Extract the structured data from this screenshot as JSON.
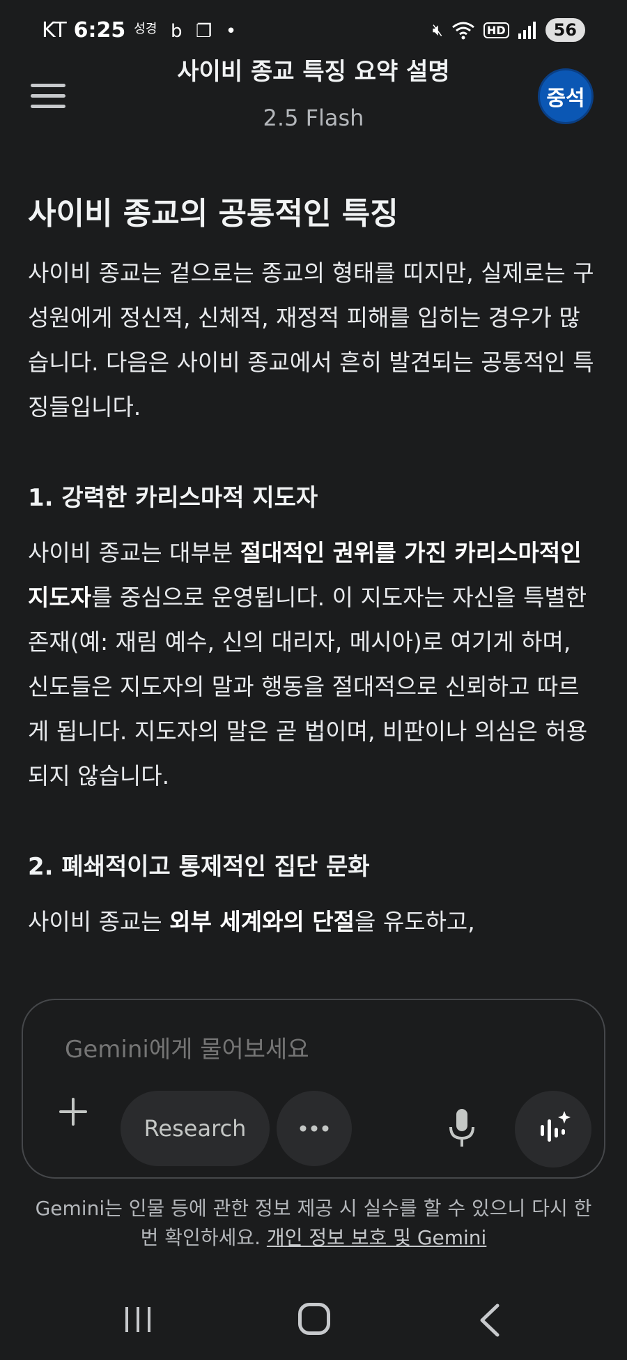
{
  "status_bar": {
    "carrier": "KT",
    "time": "6:25",
    "extra_text": "성경",
    "battery": "56"
  },
  "header": {
    "title": "사이비 종교 특징 요약 설명",
    "model": "2.5 Flash",
    "avatar_text": "중석"
  },
  "content": {
    "heading": "사이비 종교의 공통적인 특징",
    "intro": "사이비 종교는 겉으로는 종교의 형태를 띠지만, 실제로는 구성원에게 정신적, 신체적, 재정적 피해를 입히는 경우가 많습니다. 다음은 사이비 종교에서 흔히 발견되는 공통적인 특징들입니다.",
    "section1": {
      "title": "1. 강력한 카리스마적 지도자",
      "p1": "사이비 종교는 대부분 ",
      "b1": "절대적인 권위를 가진 카리스마적인 지도자",
      "p2": "를 중심으로 운영됩니다. 이 지도자는 자신을 특별한 존재(예: 재림 예수, 신의 대리자, 메시아)로 여기게 하며, 신도들은 지도자의 말과 행동을 절대적으로 신뢰하고 따르게 됩니다. 지도자의 말은 곧 법이며, 비판이나 의심은 허용되지 않습니다."
    },
    "section2": {
      "title": "2. 폐쇄적이고 통제적인 집단 문화",
      "p1": "사이비 종교는 ",
      "b1": "외부 세계와의 단절",
      "p2": "을 유도하고,"
    }
  },
  "composer": {
    "placeholder": "Gemini에게 물어보세요",
    "research_label": "Research",
    "plus_icon": "plus-icon",
    "more_icon": "more-horizontal-icon",
    "mic_icon": "mic-icon",
    "live_icon": "gemini-live-icon"
  },
  "disclaimer": {
    "text": "Gemini는 인물 등에 관한 정보 제공 시 실수를 할 수 있으니 다시 한번 확인하세요. ",
    "link": "개인 정보 보호 및 Gemini"
  }
}
